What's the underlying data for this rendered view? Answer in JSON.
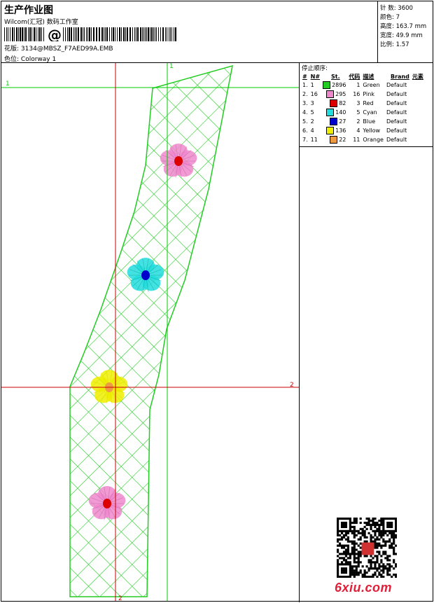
{
  "header": {
    "title": "生产作业图",
    "studio": "Wilcom(汇冠) 数码工作室",
    "barcode_symbol": "@",
    "design_label": "花版:",
    "design_file": "3134@MBSZ_F7AED99A.EMB",
    "colorway_label": "色位:",
    "colorway": "Colorway 1"
  },
  "stats": {
    "stitches_label": "针 数:",
    "stitches": "3600",
    "colors_label": "颜色:",
    "colors": "7",
    "height_label": "高度:",
    "height": "163.7 mm",
    "width_label": "宽度:",
    "width": "49.9 mm",
    "scale_label": "比例:",
    "scale": "1.57"
  },
  "stop_sequence": {
    "title": "停止顺序:",
    "headers": [
      "#",
      "N#",
      "St.",
      "代码",
      "描述",
      "Brand",
      "元素"
    ],
    "rows": [
      {
        "idx": "1.",
        "n": "1",
        "st": "2896",
        "code": "1",
        "desc": "Green",
        "brand": "Default",
        "color": "#22cc22"
      },
      {
        "idx": "2.",
        "n": "16",
        "st": "295",
        "code": "16",
        "desc": "Pink",
        "brand": "Default",
        "color": "#ee88cc"
      },
      {
        "idx": "3.",
        "n": "3",
        "st": "82",
        "code": "3",
        "desc": "Red",
        "brand": "Default",
        "color": "#dd0000"
      },
      {
        "idx": "4.",
        "n": "5",
        "st": "140",
        "code": "5",
        "desc": "Cyan",
        "brand": "Default",
        "color": "#22dddd"
      },
      {
        "idx": "5.",
        "n": "2",
        "st": "27",
        "code": "2",
        "desc": "Blue",
        "brand": "Default",
        "color": "#0000cc"
      },
      {
        "idx": "6.",
        "n": "4",
        "st": "136",
        "code": "4",
        "desc": "Yellow",
        "brand": "Default",
        "color": "#eeee00"
      },
      {
        "idx": "7.",
        "n": "11",
        "st": "22",
        "code": "11",
        "desc": "Orange",
        "brand": "Default",
        "color": "#ee9944"
      }
    ]
  },
  "guides": {
    "v1_label": "1",
    "h1_label": "1",
    "h2_label": "2",
    "v2_label": "2",
    "v1_color": "#00cc00",
    "h1_color": "#00cc00",
    "h2_color": "#cc0000",
    "v2_color": "#cc0000"
  },
  "logo": "6xiu.com"
}
